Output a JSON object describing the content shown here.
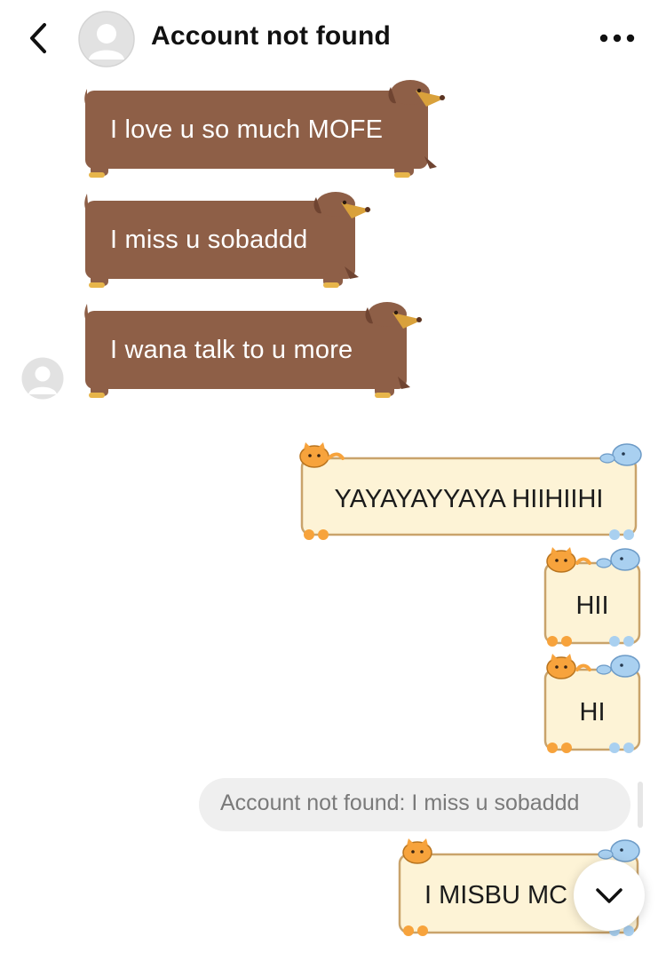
{
  "header": {
    "title": "Account not found",
    "back_icon": "chevron-left-icon",
    "more_icon": "more-horizontal-icon"
  },
  "received_messages": [
    {
      "text": "I love u so much MOFE"
    },
    {
      "text": "I miss u sobaddd"
    },
    {
      "text": "I wana talk to u more"
    }
  ],
  "sent_messages": [
    {
      "text": "YAYAYAYYAYA HIIHIIHI"
    },
    {
      "text": "HII"
    },
    {
      "text": "HI"
    }
  ],
  "reply": {
    "quote": "Account not found: I miss u sobaddd",
    "text": "I MISBU MC"
  },
  "colors": {
    "dog_bubble": "#8e5f47",
    "pet_bubble": "#fdf3d6",
    "pet_border": "#c9a36b",
    "reply_quote_bg": "#efefef"
  }
}
